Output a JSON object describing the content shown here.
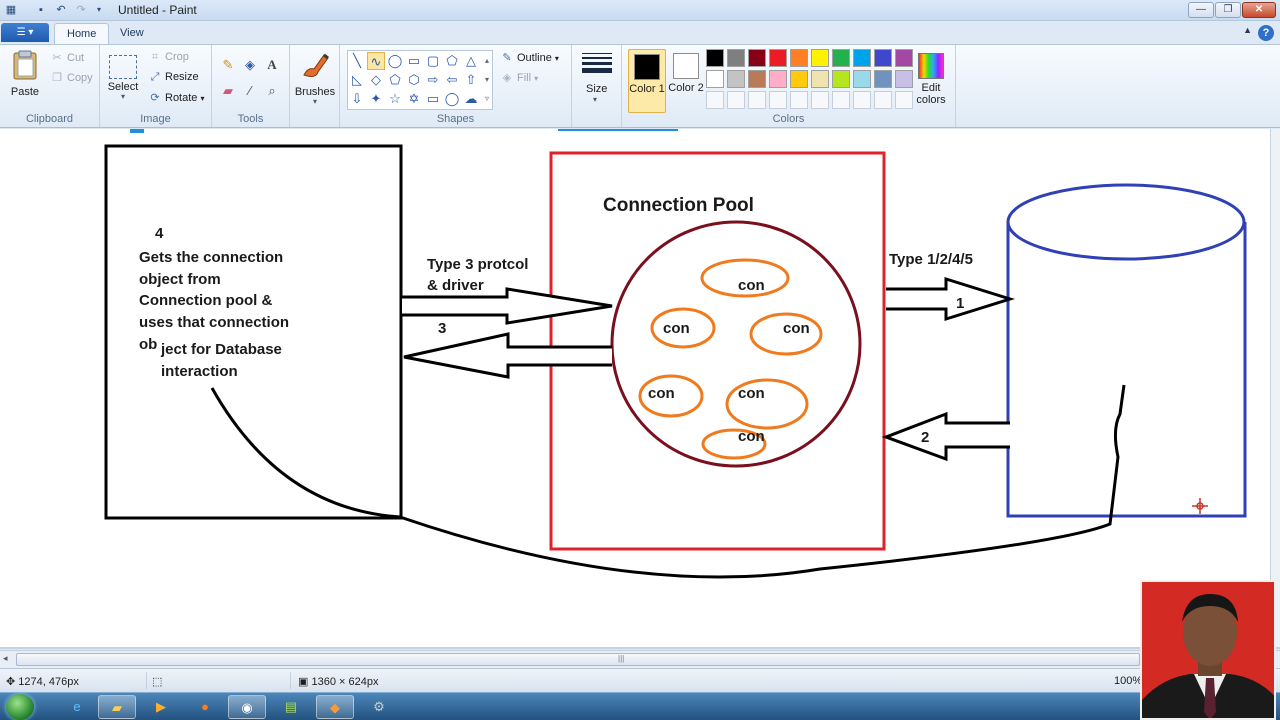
{
  "window": {
    "title": "Untitled - Paint",
    "minimize_label": "—",
    "maximize_label": "❐",
    "close_label": "✕"
  },
  "tabs": [
    {
      "label": "Home",
      "active": true
    },
    {
      "label": "View",
      "active": false
    }
  ],
  "help_label": "?",
  "ribbon": {
    "clipboard": {
      "label": "Clipboard",
      "paste": "Paste",
      "cut": "Cut",
      "copy": "Copy"
    },
    "image": {
      "label": "Image",
      "select": "Select",
      "crop": "Crop",
      "resize": "Resize",
      "rotate": "Rotate"
    },
    "tools": {
      "label": "Tools",
      "icons": [
        "pencil-icon",
        "fill-icon",
        "text-icon",
        "eraser-icon",
        "color-picker-icon",
        "magnifier-icon"
      ]
    },
    "brushes": {
      "label": "Brushes"
    },
    "shapes": {
      "label": "Shapes",
      "outline": "Outline",
      "fill": "Fill"
    },
    "size": {
      "label": "Size"
    },
    "colors": {
      "label": "Colors",
      "color1": "Color 1",
      "color2": "Color 2",
      "color1_value": "#000000",
      "color2_value": "#ffffff",
      "edit_colors": "Edit colors",
      "palette_row1": [
        "#000000",
        "#7f7f7f",
        "#880015",
        "#ed1c24",
        "#ff7f27",
        "#fff200",
        "#22b14c",
        "#00a2e8",
        "#3f48cc",
        "#a349a4"
      ],
      "palette_row2": [
        "#ffffff",
        "#c3c3c3",
        "#b97a57",
        "#ffaec9",
        "#ffc90e",
        "#efe4b0",
        "#b5e61d",
        "#99d9ea",
        "#7092be",
        "#c8bfe7"
      ]
    }
  },
  "diagram": {
    "left_box": {
      "step": "4",
      "lines": [
        "Gets the  connection",
        "object from",
        "Connection pool &",
        "uses that connection",
        "ob"
      ],
      "lines_indented": [
        "ject for Database",
        "interaction"
      ]
    },
    "pool_title": "Connection Pool",
    "connections": [
      "con",
      "con",
      "con",
      "con",
      "con",
      "con"
    ],
    "arrow_protocol": [
      "Type 3 protcol",
      "& driver"
    ],
    "arrow_3_label": "3",
    "arrow_type_label": "Type 1/2/4/5",
    "arrow_1_label": "1",
    "arrow_2_label": "2"
  },
  "statusbar": {
    "cursor_pos": "1274, 476px",
    "image_size": "1360 × 624px",
    "zoom": "100%"
  },
  "taskbar": {
    "apps": [
      "ie-icon",
      "folder-icon",
      "media-player-icon",
      "firefox-icon",
      "chrome-icon",
      "network-icon",
      "paint-icon",
      "tools-icon"
    ]
  }
}
